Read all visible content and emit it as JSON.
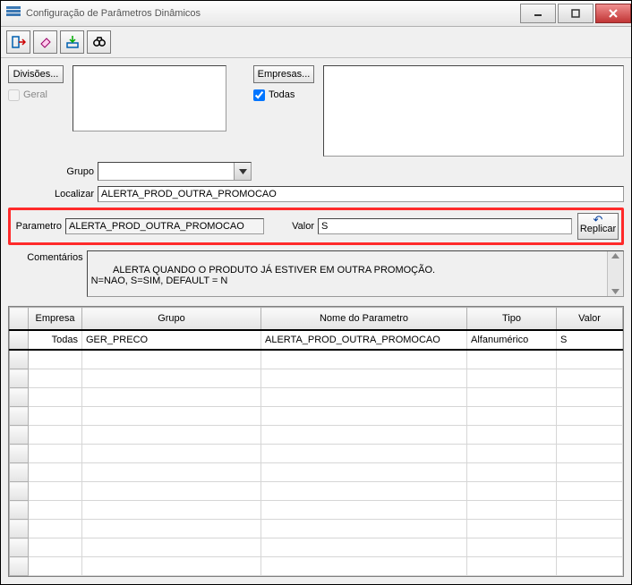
{
  "window": {
    "title": "Configuração de Parâmetros Dinâmicos"
  },
  "toolbar": {
    "btn_exit": "exit",
    "btn_eraser": "eraser",
    "btn_import": "import",
    "btn_search": "search"
  },
  "filters": {
    "divisoes_btn": "Divisões...",
    "geral_label": "Geral",
    "empresas_btn": "Empresas...",
    "todas_label": "Todas",
    "todas_checked": true,
    "grupo_label": "Grupo",
    "grupo_value": "",
    "localizar_label": "Localizar",
    "localizar_value": "ALERTA_PROD_OUTRA_PROMOCAO"
  },
  "param_row": {
    "parametro_label": "Parametro",
    "parametro_value": "ALERTA_PROD_OUTRA_PROMOCAO",
    "valor_label": "Valor",
    "valor_value": "S",
    "replicar_label": "Replicar"
  },
  "comments": {
    "label": "Comentários",
    "text": "ALERTA QUANDO O PRODUTO JÁ ESTIVER EM OUTRA PROMOÇÃO.\nN=NAO, S=SIM, DEFAULT = N"
  },
  "grid": {
    "headers": {
      "empresa": "Empresa",
      "grupo": "Grupo",
      "nome": "Nome do Parametro",
      "tipo": "Tipo",
      "valor": "Valor"
    },
    "rows": [
      {
        "empresa": "Todas",
        "grupo": "GER_PRECO",
        "nome": "ALERTA_PROD_OUTRA_PROMOCAO",
        "tipo": "Alfanumérico",
        "valor": "S"
      }
    ]
  }
}
